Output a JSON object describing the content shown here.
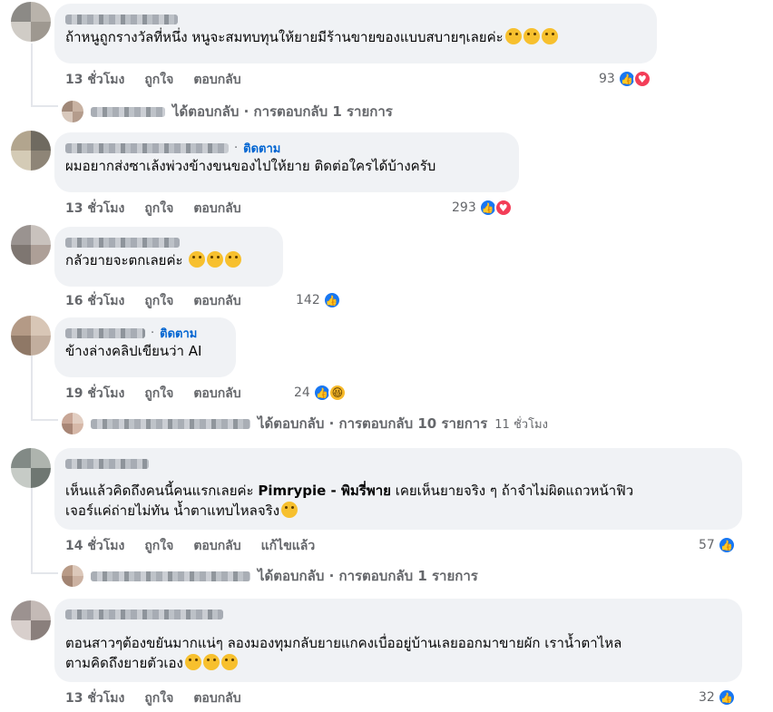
{
  "comments": [
    {
      "text": "ถ้าหนูถูกรางวัลที่หนึ่ง หนูจะสมทบทุนให้ยายมีร้านขายของแบบสบายๆเลยค่ะ",
      "emoji": [
        "😳",
        "😳",
        "😳"
      ],
      "time": "13 ชั่วโมง",
      "like": "ถูกใจ",
      "reply": "ตอบกลับ",
      "reactions": {
        "count": "93",
        "types": [
          "like-icon",
          "love-icon"
        ]
      },
      "replies_label": "ได้ตอบกลับ · การตอบกลับ 1 รายการ"
    },
    {
      "follow": "ติดตาม",
      "text": "ผมอยากส่งซาเล้งพ่วงข้างขนของไปให้ยาย ติดต่อใครได้บ้างครับ",
      "time": "13 ชั่วโมง",
      "like": "ถูกใจ",
      "reply": "ตอบกลับ",
      "reactions": {
        "count": "293",
        "types": [
          "like-icon",
          "love-icon"
        ]
      }
    },
    {
      "text": "กลัวยายจะตกเลยค่ะ",
      "emoji": [
        "😭",
        "😭",
        "😭"
      ],
      "time": "16 ชั่วโมง",
      "like": "ถูกใจ",
      "reply": "ตอบกลับ",
      "reactions": {
        "count": "142",
        "types": [
          "like-icon"
        ]
      }
    },
    {
      "follow": "ติดตาม",
      "text": "ข้างล่างคลิปเขียนว่า AI",
      "time": "19 ชั่วโมง",
      "like": "ถูกใจ",
      "reply": "ตอบกลับ",
      "reactions": {
        "count": "24",
        "types": [
          "like-icon",
          "haha-icon"
        ]
      },
      "replies_label": "ได้ตอบกลับ · การตอบกลับ 10 รายการ",
      "replies_time": "11 ชั่วโมง"
    },
    {
      "text_line1_a": "เห็นแล้วคิดถึงคนนี้คนแรกเลยค่ะ ",
      "text_line1_bold": "Pimrypie - พิมรี่พาย",
      "text_line1_b": " เคยเห็นยายจริง ๆ ถ้าจำไม่ผิดแถวหน้าฟิว",
      "text_line2": "เจอร์แค่ถ่ายไม่ทัน น้ำตาแทบไหลจริง",
      "emoji": [
        "😞"
      ],
      "time": "14 ชั่วโมง",
      "like": "ถูกใจ",
      "reply": "ตอบกลับ",
      "edited": "แก้ไขแล้ว",
      "reactions": {
        "count": "57",
        "types": [
          "like-icon"
        ]
      },
      "replies_label": "ได้ตอบกลับ · การตอบกลับ 1 รายการ"
    },
    {
      "text_line1": "ตอนสาวๆต้องขยันมากแน่ๆ ลองมองทุมกลับยายแกคงเบื่ออยู่บ้านเลยออกมาขายผัก เราน้ำตาไหล",
      "text_line2": "ตามคิดถึงยายตัวเอง",
      "emoji": [
        "😭",
        "😭",
        "😭"
      ],
      "time": "13 ชั่วโมง",
      "like": "ถูกใจ",
      "reply": "ตอบกลับ",
      "reactions": {
        "count": "32",
        "types": [
          "like-icon"
        ]
      }
    }
  ],
  "colors": {
    "like": "#1877f2",
    "love": "#f33e58",
    "haha": "#f7b928",
    "link": "#0064d1",
    "bubble": "#f0f2f5",
    "meta": "#65676b"
  }
}
